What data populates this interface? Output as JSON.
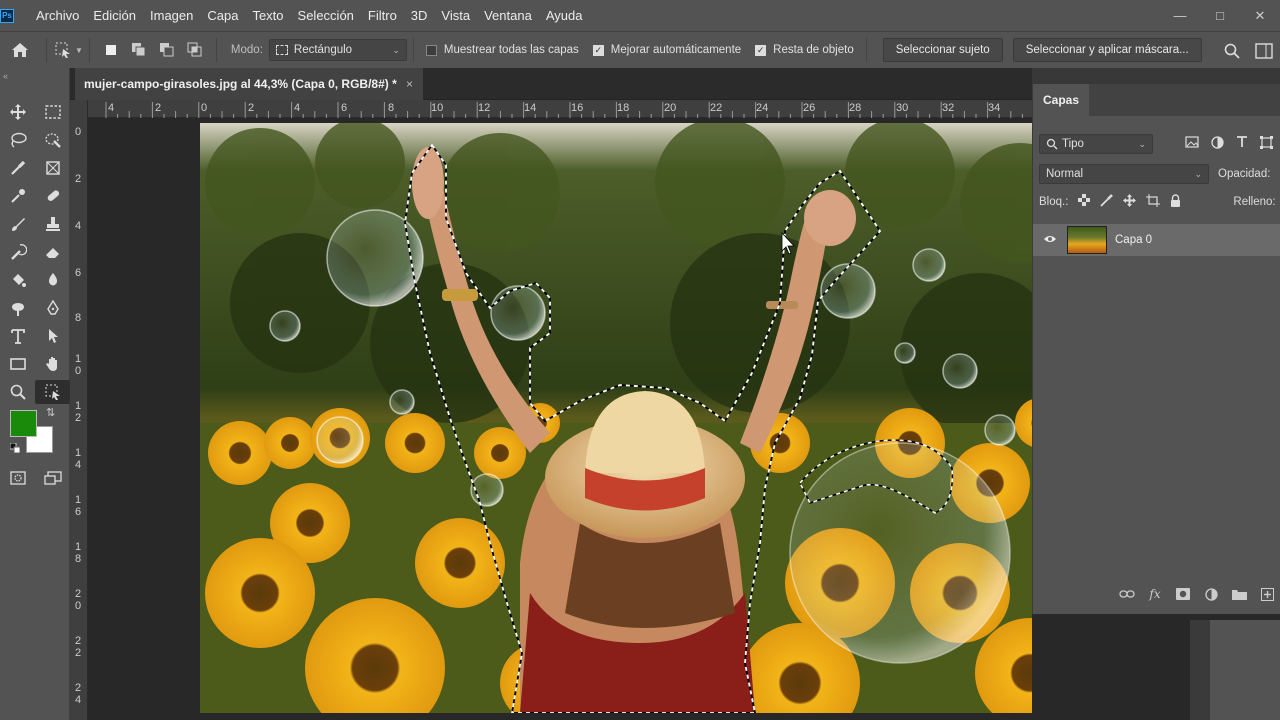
{
  "app": {
    "logo": "Ps"
  },
  "menu": [
    "Archivo",
    "Edición",
    "Imagen",
    "Capa",
    "Texto",
    "Selección",
    "Filtro",
    "3D",
    "Vista",
    "Ventana",
    "Ayuda"
  ],
  "window_controls": [
    "minimize-icon",
    "maximize-icon",
    "close-icon"
  ],
  "options_bar": {
    "mode_label": "Modo:",
    "mode_value": "Rectángulo",
    "checkbox_all_layers": {
      "label": "Muestrear todas las capas",
      "checked": false
    },
    "checkbox_enhance": {
      "label": "Mejorar automáticamente",
      "checked": true
    },
    "checkbox_subtract": {
      "label": "Resta de objeto",
      "checked": true
    },
    "btn_select_subject": "Seleccionar sujeto",
    "btn_select_mask": "Seleccionar y aplicar máscara..."
  },
  "document": {
    "tab_title": "mujer-campo-girasoles.jpg al 44,3% (Capa 0, RGB/8#) *",
    "close": "×"
  },
  "ruler_h": [
    "4",
    "2",
    "0",
    "2",
    "4",
    "6",
    "8",
    "10",
    "12",
    "14",
    "16",
    "18",
    "20",
    "22",
    "24",
    "26",
    "28",
    "30",
    "32",
    "34"
  ],
  "ruler_v": [
    "0",
    "2",
    "4",
    "6",
    "8",
    "10",
    "12",
    "14",
    "16",
    "18",
    "20",
    "22",
    "24"
  ],
  "layers_panel": {
    "tab": "Capas",
    "filter_value": "Tipo",
    "blend_mode": "Normal",
    "opacity_label": "Opacidad:",
    "lock_label": "Bloq.:",
    "fill_label": "Relleno:",
    "layers": [
      {
        "name": "Capa 0",
        "visible": true
      }
    ]
  },
  "colors": {
    "foreground": "#1a8a0a",
    "background": "#ffffff",
    "accent": "#31a8ff"
  }
}
